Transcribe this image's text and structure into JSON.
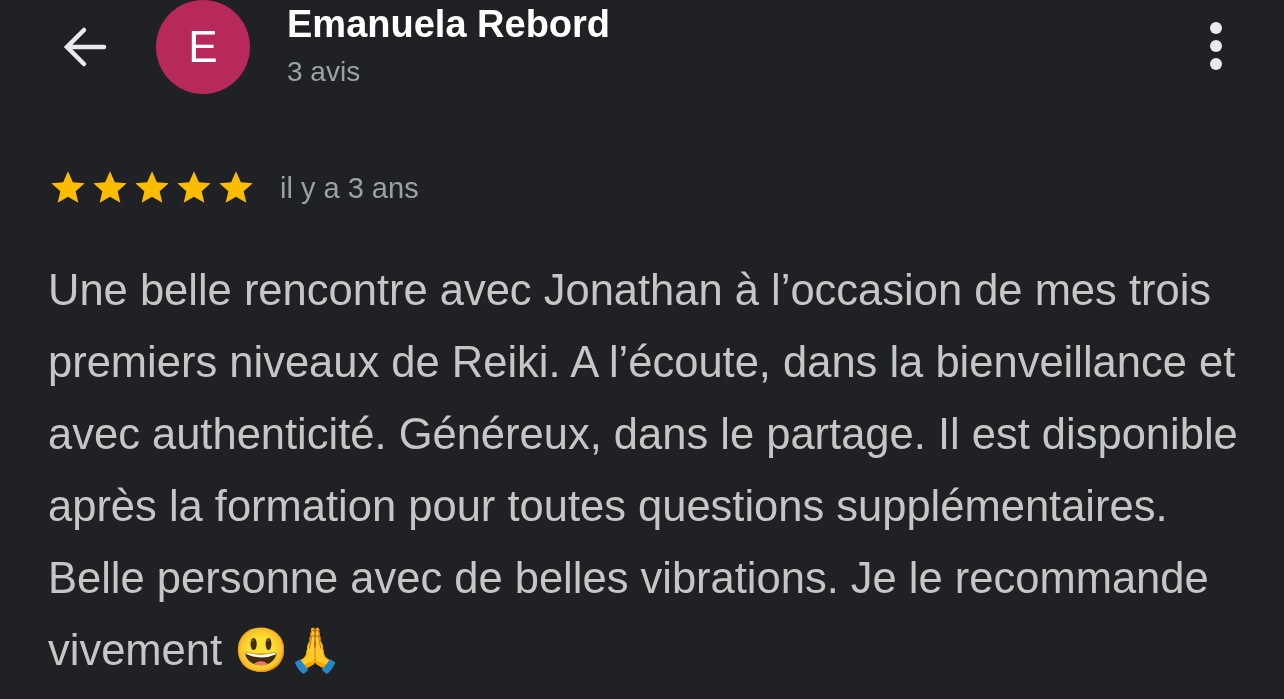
{
  "reviewer": {
    "initial": "E",
    "color": "#b7295a",
    "name": "Emanuela Rebord",
    "review_count": "3 avis"
  },
  "review": {
    "stars": 5,
    "time": "il y a 3 ans",
    "text": "Une belle rencontre avec Jonathan à l’occasion de mes trois premiers niveaux de Reiki. A l’écoute, dans la bienveillance et avec authenticité. Généreux, dans le partage. Il est disponible après la formation pour toutes questions supplémentaires. Belle personne avec de belles vibrations. Je le recommande vivement 😃🙏"
  }
}
